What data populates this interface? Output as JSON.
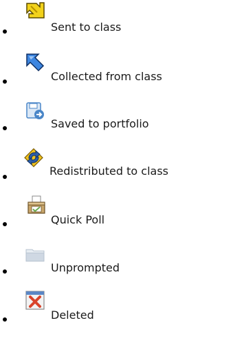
{
  "legend": {
    "items": [
      {
        "label": "Sent to class",
        "icon": "sent-arrow-icon"
      },
      {
        "label": "Collected from class",
        "icon": "collected-arrow-icon"
      },
      {
        "label": "Saved to portfolio",
        "icon": "save-portfolio-icon"
      },
      {
        "label": "Redistributed to class",
        "icon": "redistribute-icon"
      },
      {
        "label": "Quick Poll",
        "icon": "quick-poll-box-icon"
      },
      {
        "label": "Unprompted",
        "icon": "folder-icon"
      },
      {
        "label": "Deleted",
        "icon": "deleted-x-icon"
      }
    ]
  },
  "colors": {
    "text": "#1a1a1a",
    "bullet": "#000000",
    "sent_yellow": "#f2d21b",
    "collected_blue": "#3d86e0",
    "portfolio_blue": "#4a86c8",
    "redistribute_blue": "#2f5fa8",
    "redistribute_yellow": "#f0c21e",
    "poll_tan": "#c9a66b",
    "poll_green": "#6aa84f",
    "folder_grey": "#cfd8e3",
    "deleted_red": "#d9442b"
  }
}
